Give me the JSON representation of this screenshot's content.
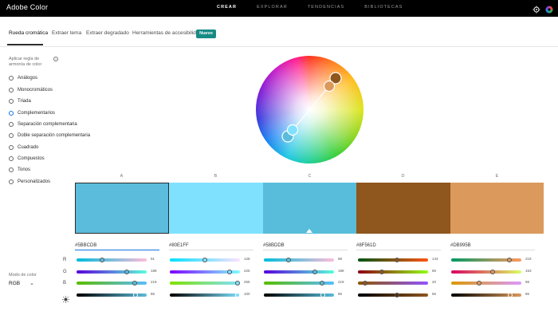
{
  "app": {
    "title": "Adobe Color",
    "nav": [
      "CREAR",
      "EXPLORAR",
      "TENDENCIAS",
      "BIBLIOTECAS"
    ],
    "active_nav": "CREAR",
    "icons": [
      "settings-icon",
      "adobe-color-icon"
    ]
  },
  "subtabs": {
    "items": [
      "Rueda cromática",
      "Extraer tema",
      "Extraer degradado",
      "Herramientas de accesibilidad"
    ],
    "badge": "Nuevo"
  },
  "sidebar": {
    "rule_label": "Aplicar regla de armonía de color",
    "rules": [
      "Análogos",
      "Monocromáticos",
      "Triada",
      "Complementarios",
      "Separación complementaria",
      "Doble separación complementaria",
      "Cuadrado",
      "Compuestos",
      "Tonos",
      "Personalizados"
    ],
    "selected_rule": "Complementarios",
    "mode_label": "Modo de color",
    "mode_value": "RGB"
  },
  "channel_labels": [
    "R",
    "G",
    "B"
  ],
  "swatches": [
    {
      "label": "A",
      "hex": "#5BBCDB",
      "color": "#5bbcdb",
      "r": 91,
      "g": 188,
      "b": 219,
      "brightness": 86
    },
    {
      "label": "B",
      "hex": "#80E1FF",
      "color": "#80e1ff",
      "r": 128,
      "g": 225,
      "b": 255,
      "brightness": 100
    },
    {
      "label": "C",
      "hex": "#58BDDB",
      "color": "#58bddb",
      "r": 88,
      "g": 189,
      "b": 219,
      "brightness": 86
    },
    {
      "label": "D",
      "hex": "#8F561D",
      "color": "#8f561d",
      "r": 143,
      "g": 85,
      "b": 20,
      "brightness": 56
    },
    {
      "label": "E",
      "hex": "#DB995B",
      "color": "#db995b",
      "r": 219,
      "g": 153,
      "b": 98,
      "brightness": 86
    }
  ],
  "selected_swatch": "A"
}
